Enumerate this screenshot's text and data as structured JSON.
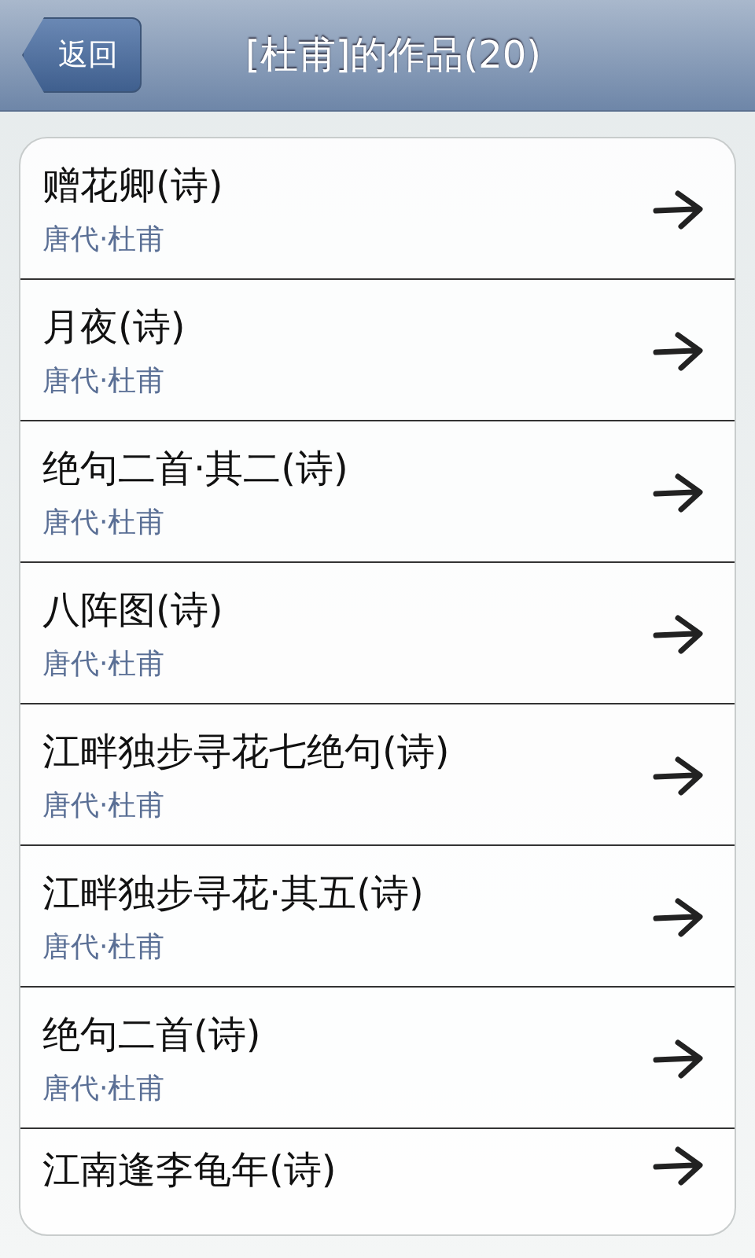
{
  "header": {
    "back_button": "返回",
    "title": "[杜甫]的作品(20)"
  },
  "works": [
    {
      "title": "赠花卿(诗)",
      "author": "唐代·杜甫"
    },
    {
      "title": "月夜(诗)",
      "author": "唐代·杜甫"
    },
    {
      "title": "绝句二首·其二(诗)",
      "author": "唐代·杜甫"
    },
    {
      "title": "八阵图(诗)",
      "author": "唐代·杜甫"
    },
    {
      "title": "江畔独步寻花七绝句(诗)",
      "author": "唐代·杜甫"
    },
    {
      "title": "江畔独步寻花·其五(诗)",
      "author": "唐代·杜甫"
    },
    {
      "title": "绝句二首(诗)",
      "author": "唐代·杜甫"
    },
    {
      "title": "江南逢李龟年(诗)"
    }
  ]
}
